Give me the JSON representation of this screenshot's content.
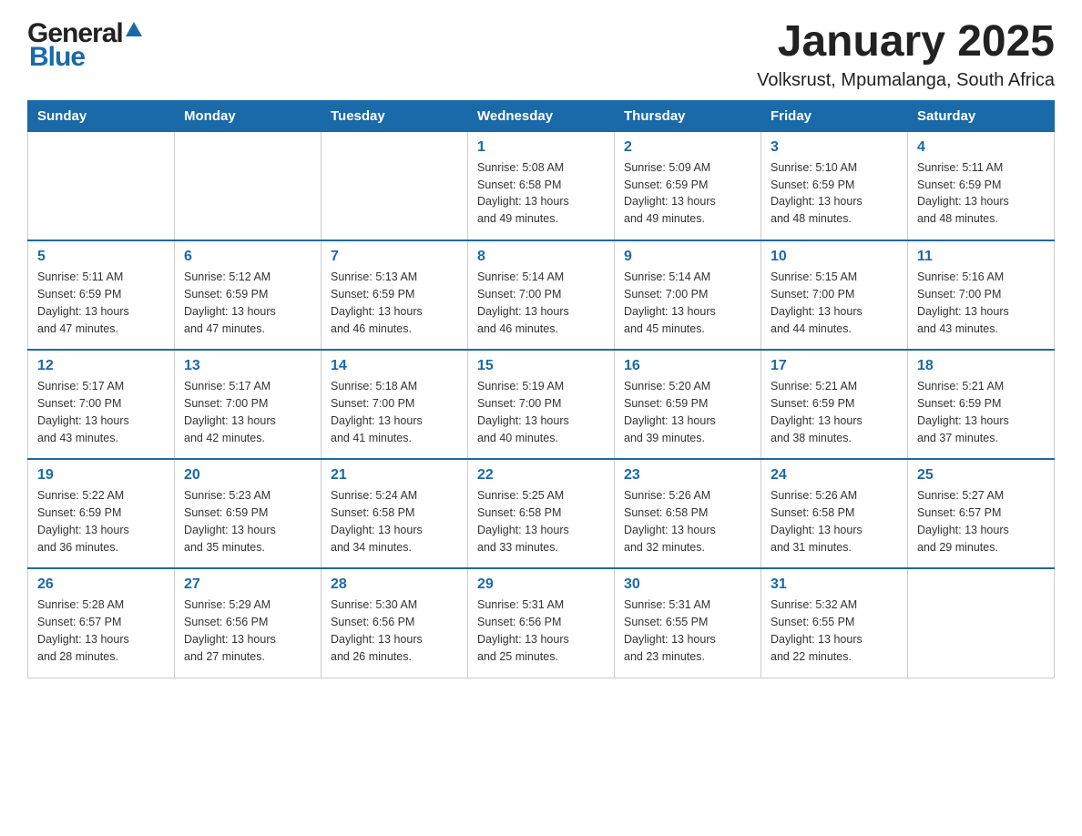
{
  "header": {
    "logo_general": "General",
    "logo_blue": "Blue",
    "title": "January 2025",
    "subtitle": "Volksrust, Mpumalanga, South Africa"
  },
  "days_of_week": [
    "Sunday",
    "Monday",
    "Tuesday",
    "Wednesday",
    "Thursday",
    "Friday",
    "Saturday"
  ],
  "weeks": [
    {
      "days": [
        {
          "num": "",
          "info": ""
        },
        {
          "num": "",
          "info": ""
        },
        {
          "num": "",
          "info": ""
        },
        {
          "num": "1",
          "info": "Sunrise: 5:08 AM\nSunset: 6:58 PM\nDaylight: 13 hours\nand 49 minutes."
        },
        {
          "num": "2",
          "info": "Sunrise: 5:09 AM\nSunset: 6:59 PM\nDaylight: 13 hours\nand 49 minutes."
        },
        {
          "num": "3",
          "info": "Sunrise: 5:10 AM\nSunset: 6:59 PM\nDaylight: 13 hours\nand 48 minutes."
        },
        {
          "num": "4",
          "info": "Sunrise: 5:11 AM\nSunset: 6:59 PM\nDaylight: 13 hours\nand 48 minutes."
        }
      ]
    },
    {
      "days": [
        {
          "num": "5",
          "info": "Sunrise: 5:11 AM\nSunset: 6:59 PM\nDaylight: 13 hours\nand 47 minutes."
        },
        {
          "num": "6",
          "info": "Sunrise: 5:12 AM\nSunset: 6:59 PM\nDaylight: 13 hours\nand 47 minutes."
        },
        {
          "num": "7",
          "info": "Sunrise: 5:13 AM\nSunset: 6:59 PM\nDaylight: 13 hours\nand 46 minutes."
        },
        {
          "num": "8",
          "info": "Sunrise: 5:14 AM\nSunset: 7:00 PM\nDaylight: 13 hours\nand 46 minutes."
        },
        {
          "num": "9",
          "info": "Sunrise: 5:14 AM\nSunset: 7:00 PM\nDaylight: 13 hours\nand 45 minutes."
        },
        {
          "num": "10",
          "info": "Sunrise: 5:15 AM\nSunset: 7:00 PM\nDaylight: 13 hours\nand 44 minutes."
        },
        {
          "num": "11",
          "info": "Sunrise: 5:16 AM\nSunset: 7:00 PM\nDaylight: 13 hours\nand 43 minutes."
        }
      ]
    },
    {
      "days": [
        {
          "num": "12",
          "info": "Sunrise: 5:17 AM\nSunset: 7:00 PM\nDaylight: 13 hours\nand 43 minutes."
        },
        {
          "num": "13",
          "info": "Sunrise: 5:17 AM\nSunset: 7:00 PM\nDaylight: 13 hours\nand 42 minutes."
        },
        {
          "num": "14",
          "info": "Sunrise: 5:18 AM\nSunset: 7:00 PM\nDaylight: 13 hours\nand 41 minutes."
        },
        {
          "num": "15",
          "info": "Sunrise: 5:19 AM\nSunset: 7:00 PM\nDaylight: 13 hours\nand 40 minutes."
        },
        {
          "num": "16",
          "info": "Sunrise: 5:20 AM\nSunset: 6:59 PM\nDaylight: 13 hours\nand 39 minutes."
        },
        {
          "num": "17",
          "info": "Sunrise: 5:21 AM\nSunset: 6:59 PM\nDaylight: 13 hours\nand 38 minutes."
        },
        {
          "num": "18",
          "info": "Sunrise: 5:21 AM\nSunset: 6:59 PM\nDaylight: 13 hours\nand 37 minutes."
        }
      ]
    },
    {
      "days": [
        {
          "num": "19",
          "info": "Sunrise: 5:22 AM\nSunset: 6:59 PM\nDaylight: 13 hours\nand 36 minutes."
        },
        {
          "num": "20",
          "info": "Sunrise: 5:23 AM\nSunset: 6:59 PM\nDaylight: 13 hours\nand 35 minutes."
        },
        {
          "num": "21",
          "info": "Sunrise: 5:24 AM\nSunset: 6:58 PM\nDaylight: 13 hours\nand 34 minutes."
        },
        {
          "num": "22",
          "info": "Sunrise: 5:25 AM\nSunset: 6:58 PM\nDaylight: 13 hours\nand 33 minutes."
        },
        {
          "num": "23",
          "info": "Sunrise: 5:26 AM\nSunset: 6:58 PM\nDaylight: 13 hours\nand 32 minutes."
        },
        {
          "num": "24",
          "info": "Sunrise: 5:26 AM\nSunset: 6:58 PM\nDaylight: 13 hours\nand 31 minutes."
        },
        {
          "num": "25",
          "info": "Sunrise: 5:27 AM\nSunset: 6:57 PM\nDaylight: 13 hours\nand 29 minutes."
        }
      ]
    },
    {
      "days": [
        {
          "num": "26",
          "info": "Sunrise: 5:28 AM\nSunset: 6:57 PM\nDaylight: 13 hours\nand 28 minutes."
        },
        {
          "num": "27",
          "info": "Sunrise: 5:29 AM\nSunset: 6:56 PM\nDaylight: 13 hours\nand 27 minutes."
        },
        {
          "num": "28",
          "info": "Sunrise: 5:30 AM\nSunset: 6:56 PM\nDaylight: 13 hours\nand 26 minutes."
        },
        {
          "num": "29",
          "info": "Sunrise: 5:31 AM\nSunset: 6:56 PM\nDaylight: 13 hours\nand 25 minutes."
        },
        {
          "num": "30",
          "info": "Sunrise: 5:31 AM\nSunset: 6:55 PM\nDaylight: 13 hours\nand 23 minutes."
        },
        {
          "num": "31",
          "info": "Sunrise: 5:32 AM\nSunset: 6:55 PM\nDaylight: 13 hours\nand 22 minutes."
        },
        {
          "num": "",
          "info": ""
        }
      ]
    }
  ]
}
